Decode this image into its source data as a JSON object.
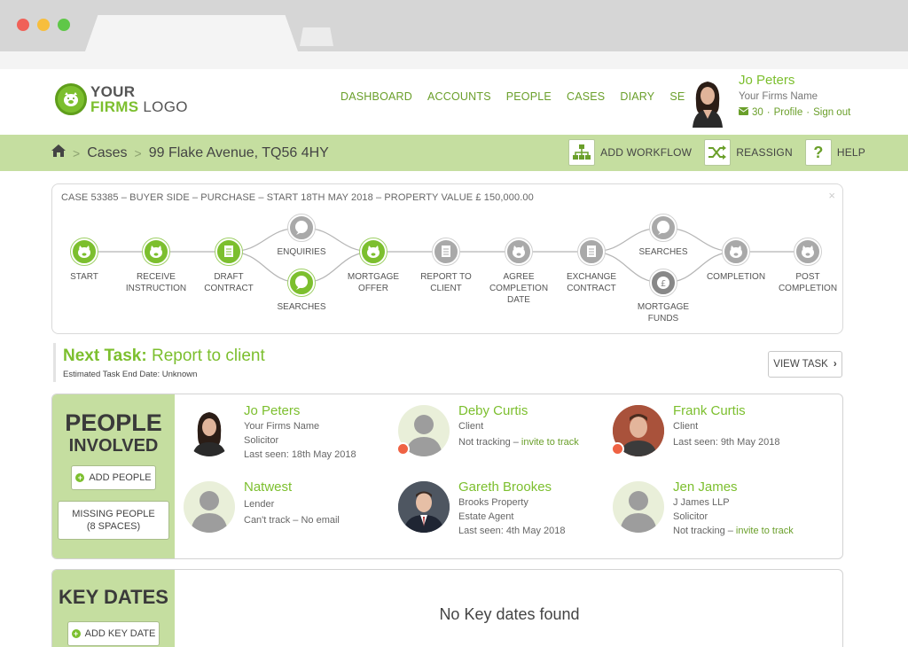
{
  "header": {
    "logo_line1": "YOUR",
    "logo_line2_green": "FIRMS",
    "logo_line2_rest": " LOGO",
    "nav": [
      "DASHBOARD",
      "ACCOUNTS",
      "PEOPLE",
      "CASES",
      "DIARY",
      "SETUP"
    ],
    "user": {
      "name": "Jo Peters",
      "firm": "Your Firms Name",
      "messages": "30",
      "profile": "Profile",
      "signout": "Sign out",
      "sep": "·"
    }
  },
  "breadcrumb": {
    "cases": "Cases",
    "property": "99 Flake Avenue, TQ56 4HY"
  },
  "actions": {
    "add_workflow": "ADD WORKFLOW",
    "reassign": "REASSIGN",
    "help": "HELP"
  },
  "workflow": {
    "title": "CASE 53385 – BUYER SIDE – PURCHASE – START 18TH MAY 2018 – PROPERTY VALUE £ 150,000.00",
    "close": "×",
    "nodes": [
      {
        "id": "start",
        "label": "START",
        "state": "done",
        "icon": "pig-icon"
      },
      {
        "id": "receive",
        "label": "RECEIVE\nINSTRUCTION",
        "state": "done",
        "icon": "pig-icon"
      },
      {
        "id": "draft",
        "label": "DRAFT\nCONTRACT",
        "state": "done",
        "icon": "document-icon"
      },
      {
        "id": "enquiries",
        "label": "ENQUIRIES",
        "state": "pending",
        "icon": "speech-bubble-icon"
      },
      {
        "id": "searches1",
        "label": "SEARCHES",
        "state": "done",
        "icon": "speech-bubble-icon"
      },
      {
        "id": "mortgage_offer",
        "label": "MORTGAGE\nOFFER",
        "state": "done",
        "icon": "pig-icon"
      },
      {
        "id": "report",
        "label": "REPORT TO\nCLIENT",
        "state": "pending",
        "icon": "document-icon"
      },
      {
        "id": "agree",
        "label": "AGREE\nCOMPLETION\nDATE",
        "state": "pending",
        "icon": "pig-icon"
      },
      {
        "id": "exchange",
        "label": "EXCHANGE\nCONTRACT",
        "state": "pending",
        "icon": "document-icon"
      },
      {
        "id": "searches2",
        "label": "SEARCHES",
        "state": "pending",
        "icon": "speech-bubble-icon"
      },
      {
        "id": "funds",
        "label": "MORTGAGE\nFUNDS",
        "state": "pending-dark",
        "icon": "pound-icon"
      },
      {
        "id": "completion",
        "label": "COMPLETION",
        "state": "pending",
        "icon": "pig-icon"
      },
      {
        "id": "post",
        "label": "POST\nCOMPLETION",
        "state": "pending",
        "icon": "pig-icon"
      }
    ]
  },
  "next_task": {
    "prefix": "Next Task:",
    "name": "Report to client",
    "sub": "Estimated Task End Date: Unknown",
    "button": "VIEW TASK"
  },
  "people": {
    "title1": "PEOPLE",
    "title2": "INVOLVED",
    "add": "ADD PEOPLE",
    "missing": "MISSING PEOPLE\n(8 SPACES)",
    "list": [
      {
        "name": "Jo Peters",
        "lines": [
          "Your Firms Name",
          "Solicitor",
          "Last seen: 18th May 2018"
        ]
      },
      {
        "name": "Deby Curtis",
        "lines": [
          "Client"
        ],
        "status": "Not tracking – ",
        "link": "invite to track"
      },
      {
        "name": "Frank Curtis",
        "lines": [
          "Client",
          "Last seen: 9th May 2018"
        ]
      },
      {
        "name": "Natwest",
        "lines": [
          "Lender",
          "Can't track – No email"
        ]
      },
      {
        "name": "Gareth Brookes",
        "lines": [
          "Brooks Property",
          "Estate Agent",
          "Last seen: 4th May 2018"
        ]
      },
      {
        "name": "Jen James",
        "lines": [
          "J James LLP",
          "Solicitor"
        ],
        "status": "Not tracking – ",
        "link": "invite to track"
      }
    ]
  },
  "key_dates": {
    "title": "KEY DATES",
    "add": "ADD KEY DATE",
    "empty": "No Key dates found"
  },
  "colors": {
    "green": "#7cbf2e",
    "light_green": "#c5dea0",
    "grey_node": "#a9a9a9",
    "badge": "#ef6243"
  }
}
